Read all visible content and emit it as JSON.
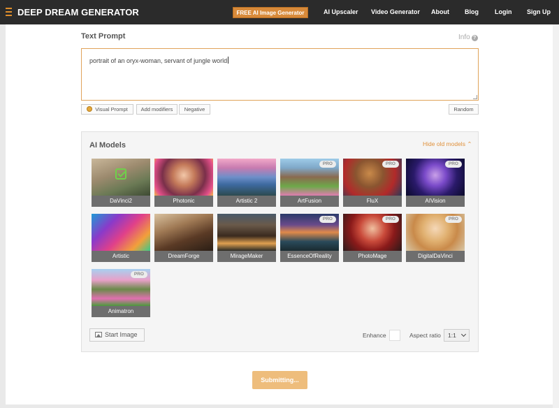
{
  "brand": {
    "name": "DEEP DREAM GENERATOR"
  },
  "nav": {
    "cta": "FREE AI Image Generator",
    "links": [
      "AI Upscaler",
      "Video Generator",
      "About",
      "Blog",
      "Login",
      "Sign Up"
    ]
  },
  "prompt": {
    "label": "Text Prompt",
    "info": "Info",
    "value": "portrait of an oryx-woman, servant of jungle world",
    "buttons": {
      "visual": "Visual Prompt",
      "modifiers": "Add modifiers",
      "negative": "Negative",
      "random": "Random"
    }
  },
  "models": {
    "title": "AI Models",
    "hide_old": "Hide old models",
    "pro_label": "PRO",
    "items": [
      {
        "name": "DaVinci2",
        "pro": false,
        "selected": true
      },
      {
        "name": "Photonic",
        "pro": false,
        "selected": false
      },
      {
        "name": "Artistic 2",
        "pro": false,
        "selected": false
      },
      {
        "name": "ArtFusion",
        "pro": true,
        "selected": false
      },
      {
        "name": "FluX",
        "pro": true,
        "selected": false
      },
      {
        "name": "AIVision",
        "pro": true,
        "selected": false
      },
      {
        "name": "Artistic",
        "pro": false,
        "selected": false
      },
      {
        "name": "DreamForge",
        "pro": false,
        "selected": false
      },
      {
        "name": "MirageMaker",
        "pro": false,
        "selected": false
      },
      {
        "name": "EssenceOfReality",
        "pro": true,
        "selected": false
      },
      {
        "name": "PhotoMage",
        "pro": true,
        "selected": false
      },
      {
        "name": "DigitalDaVinci",
        "pro": true,
        "selected": false
      },
      {
        "name": "Animatron",
        "pro": true,
        "selected": false
      }
    ]
  },
  "controls": {
    "start_image": "Start Image",
    "enhance": "Enhance",
    "aspect_ratio_label": "Aspect ratio",
    "aspect_ratio_value": "1:1"
  },
  "submit": {
    "label": "Submitting..."
  },
  "colors": {
    "accent": "#d88a3a",
    "nav_bg": "#2b2b2b",
    "caption_bg": "#6e6e6e"
  }
}
